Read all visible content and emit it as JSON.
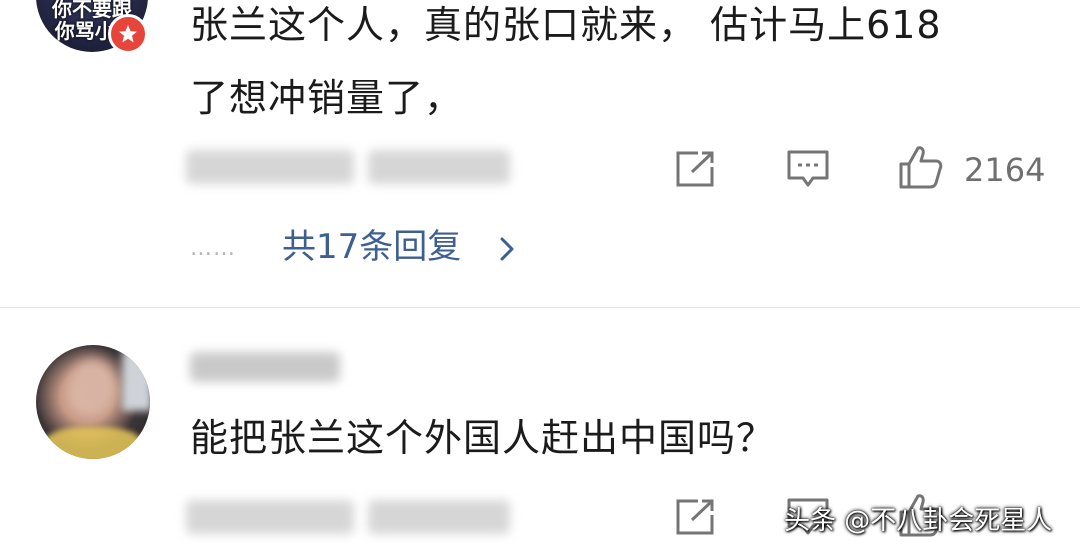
{
  "comments": [
    {
      "avatar_text_line1": "你不要跟",
      "avatar_text_line2": "你骂小S",
      "text_line1": "张兰这个人，真的张口就来， 估计马上618",
      "text_line2": "了想冲销量了，",
      "like_count": "2164",
      "replies_label": "共17条回复",
      "replies_dots": "……"
    },
    {
      "text_line1": "能把张兰这个外国人赶出中国吗？"
    }
  ],
  "icons": {
    "share": "share-icon",
    "comment": "comment-icon",
    "like": "thumbs-up-icon",
    "chevron": "chevron-right-icon",
    "badge": "star-badge-icon"
  },
  "colors": {
    "reply_link": "#3e5f92",
    "badge": "#e7443b",
    "icon_gray": "#757575"
  },
  "watermark": "头条 @不八卦会死星人"
}
